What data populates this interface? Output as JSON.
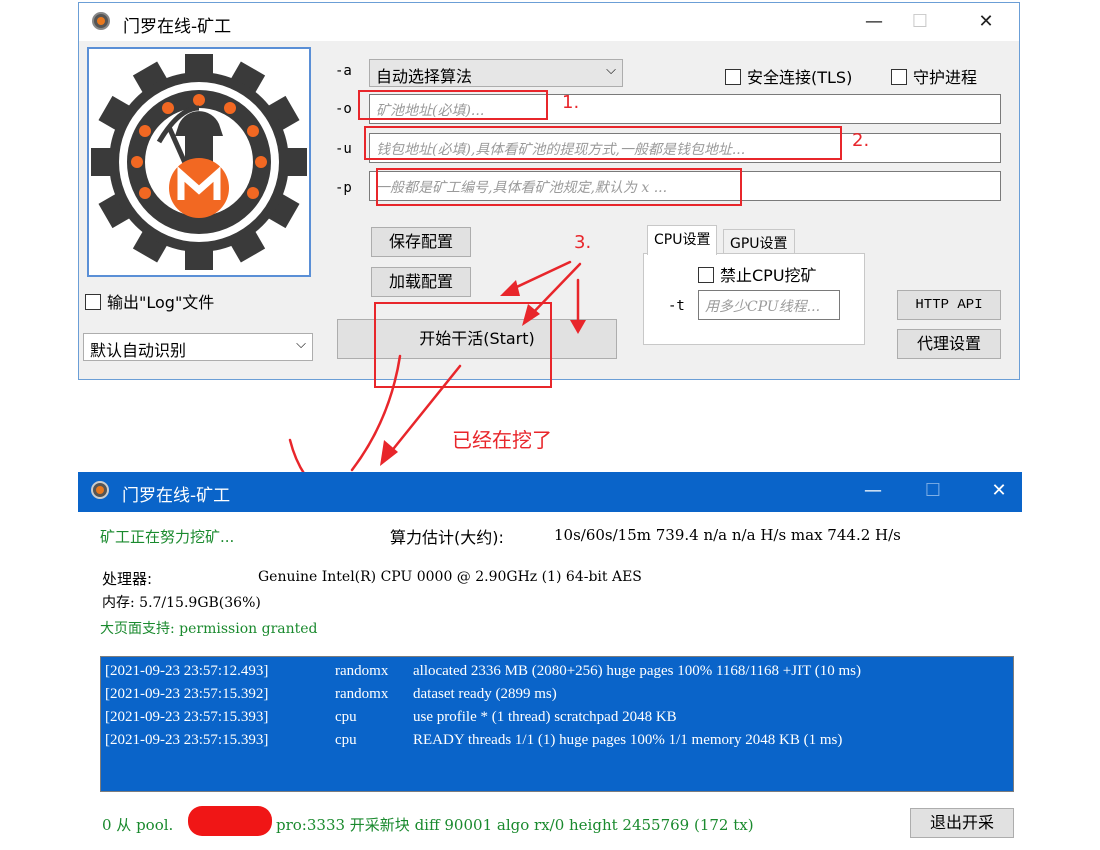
{
  "top_window": {
    "title": "门罗在线-矿工",
    "controls": {
      "minimize": "—",
      "maximize": "☐",
      "close": "✕"
    },
    "param_labels": {
      "a": "-a",
      "o": "-o",
      "u": "-u",
      "p": "-p"
    },
    "algorithm_select": "自动选择算法",
    "tls_checkbox": "安全连接(TLS)",
    "daemon_checkbox": "守护进程",
    "pool_placeholder": "矿池地址(必填)...",
    "wallet_placeholder": "钱包地址(必填),具体看矿池的提现方式,一般都是钱包地址...",
    "password_placeholder": "一般都是矿工编号,具体看矿池规定,默认为 x ...",
    "save_config": "保存配置",
    "load_config": "加载配置",
    "start_button": "开始干活(Start)",
    "output_log_checkbox": "输出\"Log\"文件",
    "auto_detect_select": "默认自动识别",
    "tabs": [
      "CPU设置",
      "GPU设置"
    ],
    "disable_cpu_checkbox": "禁止CPU挖矿",
    "threads_label": "-t",
    "threads_placeholder": "用多少CPU线程...",
    "http_api_button": "HTTP API",
    "proxy_button": "代理设置"
  },
  "annotations": {
    "step1": "1.",
    "step2": "2.",
    "step3": "3.",
    "mining_note": "已经在挖了"
  },
  "bottom_window": {
    "title": "门罗在线-矿工",
    "controls": {
      "minimize": "—",
      "maximize": "☐",
      "close": "✕"
    },
    "status": "矿工正在努力挖矿...",
    "hashrate_label": "算力估计(大约):",
    "hashrate_value": "10s/60s/15m 739.4 n/a n/a H/s max 744.2 H/s",
    "cpu_label": "处理器:",
    "cpu_value": "Genuine Intel(R) CPU 0000 @ 2.90GHz (1) 64-bit AES",
    "memory": "内存: 5.7/15.9GB(36%)",
    "hugepages": "大页面支持: permission granted",
    "log_rows": [
      {
        "time": "[2021-09-23 23:57:12.493]",
        "tag": "randomx",
        "msg": "allocated 2336 MB (2080+256) huge pages 100% 1168/1168 +JIT (10 ms)"
      },
      {
        "time": "[2021-09-23 23:57:15.392]",
        "tag": "randomx",
        "msg": "dataset ready (2899 ms)"
      },
      {
        "time": "[2021-09-23 23:57:15.393]",
        "tag": "cpu",
        "msg": "use profile  *  (1 thread) scratchpad 2048 KB"
      },
      {
        "time": "[2021-09-23 23:57:15.393]",
        "tag": "cpu",
        "msg": "READY threads 1/1 (1) huge pages 100% 1/1 memory 2048 KB (1 ms)"
      }
    ],
    "footer_prefix": "0 从 pool.",
    "footer_suffix": "pro:3333 开采新块 diff 90001 algo rx/0 height 2455769 (172 tx)",
    "exit_button": "退出开采"
  }
}
